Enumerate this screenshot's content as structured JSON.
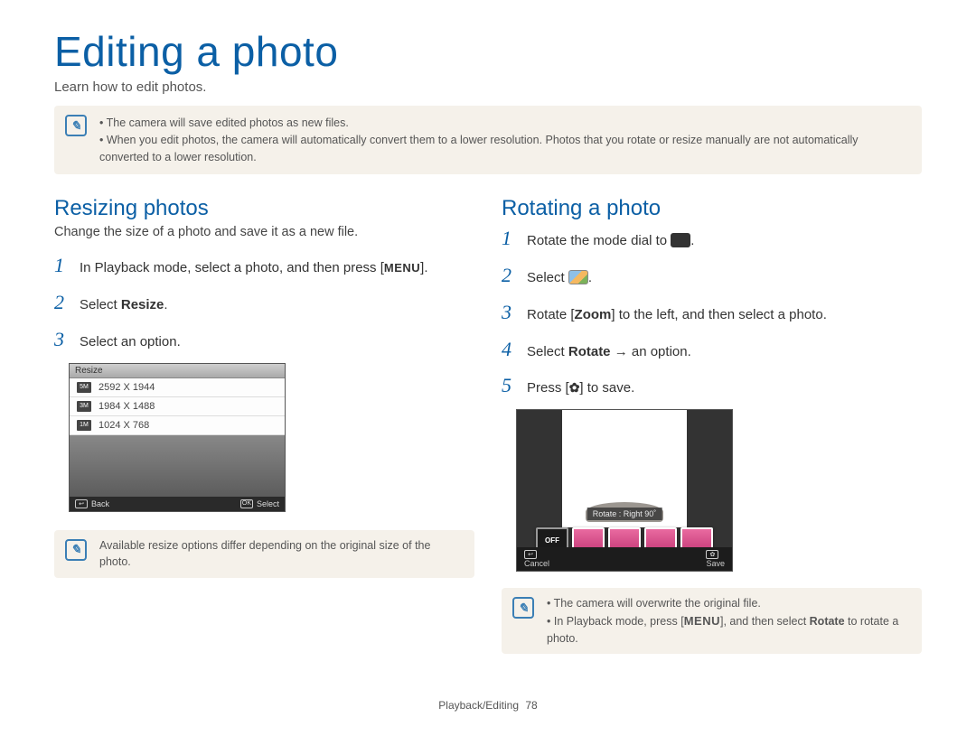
{
  "title": "Editing a photo",
  "subtitle": "Learn how to edit photos.",
  "top_note": [
    "The camera will save edited photos as new files.",
    "When you edit photos, the camera will automatically convert them to a lower resolution. Photos that you rotate or resize manually are not automatically converted to a lower resolution."
  ],
  "left": {
    "heading": "Resizing photos",
    "sub": "Change the size of a photo and save it as a new file.",
    "steps": {
      "s1_pre": "In Playback mode, select a photo, and then press [",
      "s1_menu": "MENU",
      "s1_post": "].",
      "s2_pre": "Select ",
      "s2_bold": "Resize",
      "s2_post": ".",
      "s3": "Select an option."
    },
    "lcd": {
      "header": "Resize",
      "rows": [
        {
          "badge": "5M",
          "label": "2592 X 1944"
        },
        {
          "badge": "3M",
          "label": "1984 X 1488"
        },
        {
          "badge": "1M",
          "label": "1024 X 768"
        }
      ],
      "footer_back_icon": "↩",
      "footer_back": "Back",
      "footer_select_icon": "OK",
      "footer_select": "Select"
    },
    "bottom_note": "Available resize options differ depending on the original size of the photo."
  },
  "right": {
    "heading": "Rotating a photo",
    "steps": {
      "s1_pre": "Rotate the mode dial to ",
      "s1_post": ".",
      "s2": "Select ",
      "s2_post": ".",
      "s3_pre": "Rotate [",
      "s3_bold": "Zoom",
      "s3_post": "] to the left, and then select a photo.",
      "s4_pre": "Select ",
      "s4_bold": "Rotate",
      "s4_post": " → an option.",
      "s5_pre": "Press [",
      "s5_post": "] to save.",
      "s5_icon": "✿"
    },
    "lcd": {
      "rotate_label": "Rotate : Right 90˚",
      "off": "OFF",
      "footer_cancel_icon": "↩",
      "footer_cancel": "Cancel",
      "footer_save_icon": "✿",
      "footer_save": "Save"
    },
    "bottom_note": {
      "l1": "The camera will overwrite the original file.",
      "l2_pre": "In Playback mode, press [",
      "l2_menu": "MENU",
      "l2_mid": "], and then select ",
      "l2_bold": "Rotate",
      "l2_post": " to rotate a photo."
    }
  },
  "footer": {
    "section": "Playback/Editing",
    "page": "78"
  }
}
